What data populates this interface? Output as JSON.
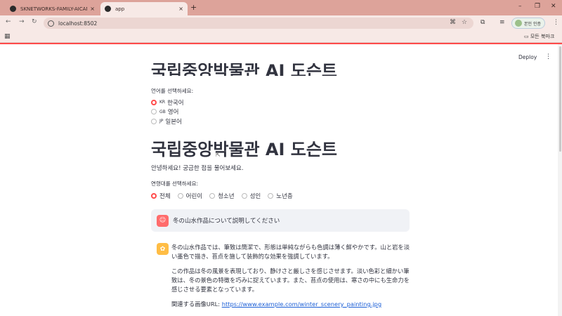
{
  "browser": {
    "tabs": [
      {
        "label": "SKNETWORKS-FAMILY-AICAMP",
        "close": "×"
      },
      {
        "label": "app",
        "close": "×"
      }
    ],
    "new_tab": "+",
    "window_controls": [
      "–",
      "❐",
      "✕"
    ],
    "url": "localhost:8502",
    "profile_label": "본인 인증",
    "bookmarks_all": "모든 북마크",
    "accent": "#ff4b4b"
  },
  "toolbar": {
    "deploy": "Deploy",
    "menu": "⋮"
  },
  "page": {
    "title_top": "국립중앙박물관 AI 도슨트",
    "language_label": "언어를 선택하세요:",
    "languages": [
      {
        "flag": "KR",
        "label": "한국어",
        "selected": true
      },
      {
        "flag": "GB",
        "label": "영어",
        "selected": false
      },
      {
        "flag": "JP",
        "label": "일본어",
        "selected": false
      }
    ],
    "title": "국립중앙박물관 AI 도슨트",
    "greeting": "안녕하세요! 궁금한 점을 물어보세요.",
    "age_label": "연령대를 선택하세요:",
    "ages": [
      {
        "label": "전체",
        "selected": true
      },
      {
        "label": "어린이",
        "selected": false
      },
      {
        "label": "청소년",
        "selected": false
      },
      {
        "label": "성인",
        "selected": false
      },
      {
        "label": "노년층",
        "selected": false
      }
    ]
  },
  "chat": {
    "user_message": "冬の山水作品について説明してください",
    "assistant_paragraphs": [
      "冬の山水作品では、筆致は簡潔で、形態は単純ながらも色調は薄く鮮やかです。山と岩を淡い墨色で描き、苔点を施して装飾的な効果を強調しています。",
      "この作品は冬の風景を表現しており、静けさと厳しさを感じさせます。淡い色彩と細かい筆致は、冬の景色の特徴を巧みに捉えています。また、苔点の使用は、寒さの中にも生命力を感じさせる要素となっています。"
    ],
    "image_label": "関連する画像URL: ",
    "image_url": "https://www.example.com/winter_scenery_painting.jpg"
  }
}
